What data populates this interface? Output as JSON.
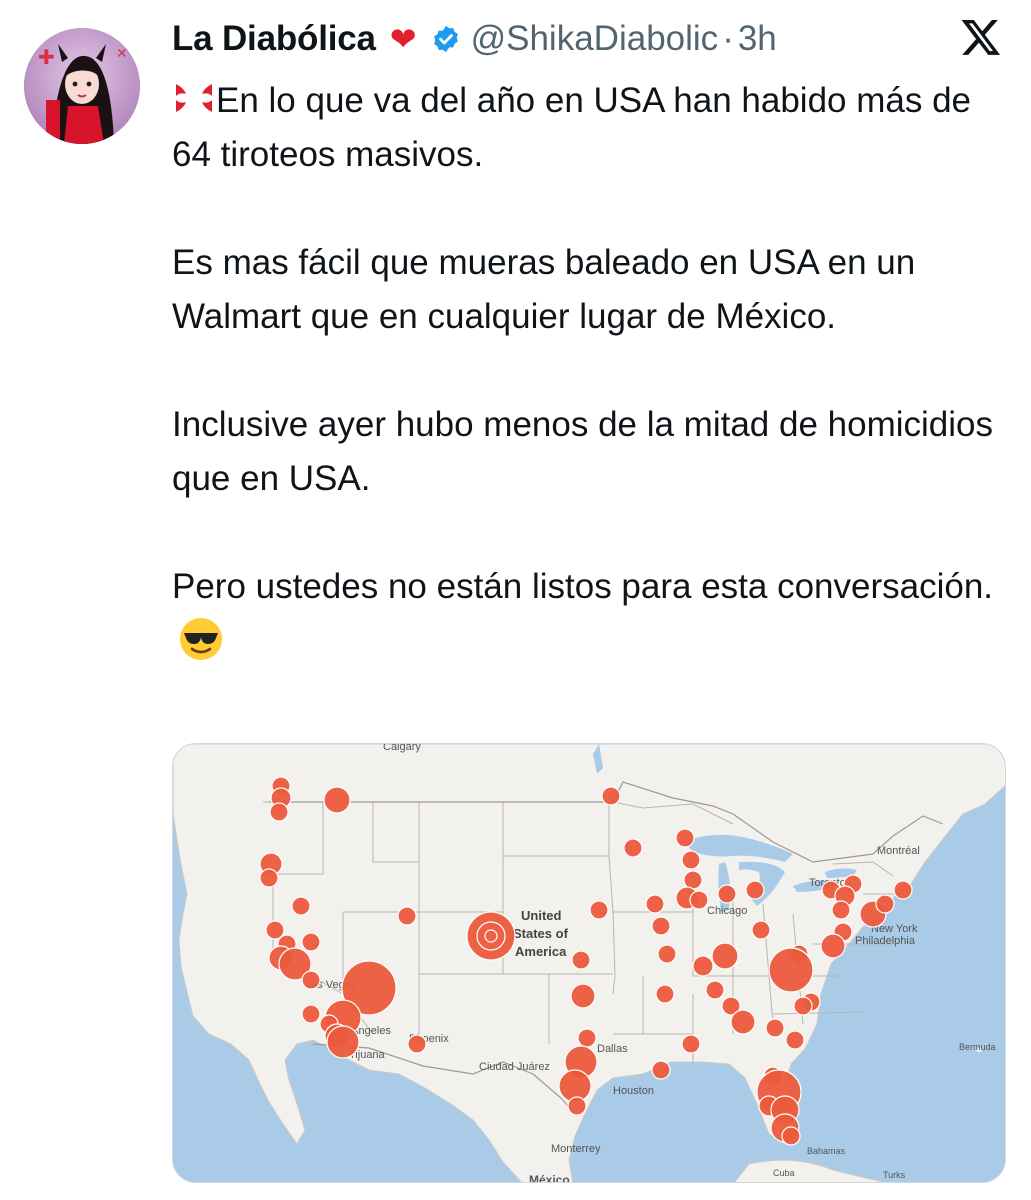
{
  "author": {
    "display_name": "La Diabólica",
    "name_emoji": "heart-emoji",
    "verified": true,
    "handle": "@ShikaDiabolic",
    "separator": "·",
    "time": "3h",
    "avatar": "profile-avatar"
  },
  "platform_logo": "x-logo-icon",
  "tweet": {
    "lead_emoji": "anger-symbol-emoji",
    "paragraphs": [
      "En lo que va del año en USA han habido más de 64 tiroteos masivos.",
      "Es mas fácil que mueras baleado en USA en un Walmart que en cualquier lugar de México.",
      "Inclusive ayer hubo menos de la mitad de homicidios que en USA.",
      "Pero ustedes no están listos para esta conversación."
    ],
    "trailing_emoji": "smiling-face-with-sunglasses-emoji"
  },
  "map": {
    "labels": {
      "calgary": "Calgary",
      "country_line1": "United",
      "country_line2": "States of",
      "country_line3": "America",
      "chicago": "Chicago",
      "toronto": "Toronto",
      "montreal": "Montréal",
      "new_york": "New York",
      "philadelphia": "Philadelphia",
      "los_angeles": "Los Angeles",
      "phoenix": "Phoenix",
      "tijuana": "Tijuana",
      "ciudad_juarez": "Ciudad Juárez",
      "dallas": "Dallas",
      "houston": "Houston",
      "monterrey": "Monterrey",
      "mexico": "México",
      "bermuda": "Bermuda",
      "bahamas": "Bahamas",
      "cuba": "Cuba",
      "turks": "Turks",
      "las_vegas": "Las Vegas"
    },
    "colors": {
      "water": "#a9cbe8",
      "land": "#f3f1ee",
      "border": "#b9b4ae",
      "marker": "#ec5a3c",
      "marker_stroke": "#ffffff"
    }
  }
}
